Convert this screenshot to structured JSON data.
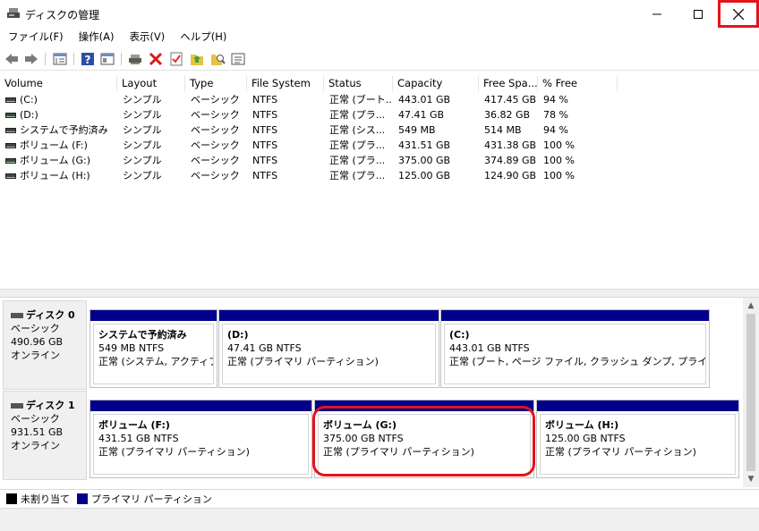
{
  "window": {
    "title": "ディスクの管理"
  },
  "menu": [
    "ファイル(F)",
    "操作(A)",
    "表示(V)",
    "ヘルプ(H)"
  ],
  "toolbar": {
    "icons": [
      "back-arrow-icon",
      "forward-arrow-icon",
      "properties-grid-icon",
      "help-icon",
      "console-tree-icon",
      "connect-icon",
      "delete-icon",
      "check-icon",
      "folder-up-icon",
      "search-folder-icon",
      "view-icon"
    ]
  },
  "volume_list": {
    "headers": [
      "Volume",
      "Layout",
      "Type",
      "File System",
      "Status",
      "Capacity",
      "Free Spa...",
      "% Free"
    ],
    "rows": [
      [
        "(C:)",
        "シンプル",
        "ベーシック",
        "NTFS",
        "正常 (ブート...",
        "443.01 GB",
        "417.45 GB",
        "94 %"
      ],
      [
        "(D:)",
        "シンプル",
        "ベーシック",
        "NTFS",
        "正常 (プラ...",
        "47.41 GB",
        "36.82 GB",
        "78 %"
      ],
      [
        "システムで予約済み",
        "シンプル",
        "ベーシック",
        "NTFS",
        "正常 (シス...",
        "549 MB",
        "514 MB",
        "94 %"
      ],
      [
        "ボリューム (F:)",
        "シンプル",
        "ベーシック",
        "NTFS",
        "正常 (プラ...",
        "431.51 GB",
        "431.38 GB",
        "100 %"
      ],
      [
        "ボリューム (G:)",
        "シンプル",
        "ベーシック",
        "NTFS",
        "正常 (プラ...",
        "375.00 GB",
        "374.89 GB",
        "100 %"
      ],
      [
        "ボリューム (H:)",
        "シンプル",
        "ベーシック",
        "NTFS",
        "正常 (プラ...",
        "125.00 GB",
        "124.90 GB",
        "100 %"
      ]
    ]
  },
  "disks": [
    {
      "name": "ディスク 0",
      "type": "ベーシック",
      "size": "490.96 GB",
      "state": "オンライン",
      "partitions": [
        {
          "name": "システムで予約済み",
          "size": "549 MB NTFS",
          "status": "正常 (システム, アクティブ, プ"
        },
        {
          "name": "(D:)",
          "size": "47.41 GB NTFS",
          "status": "正常 (プライマリ パーティション)"
        },
        {
          "name": "(C:)",
          "size": "443.01 GB NTFS",
          "status": "正常 (ブート, ページ ファイル, クラッシュ ダンプ, プライマリ パーテ"
        }
      ]
    },
    {
      "name": "ディスク 1",
      "type": "ベーシック",
      "size": "931.51 GB",
      "state": "オンライン",
      "partitions": [
        {
          "name": "ボリューム  (F:)",
          "size": "431.51 GB NTFS",
          "status": "正常 (プライマリ パーティション)"
        },
        {
          "name": "ボリューム  (G:)",
          "size": "375.00 GB NTFS",
          "status": "正常 (プライマリ パーティション)"
        },
        {
          "name": "ボリューム  (H:)",
          "size": "125.00 GB NTFS",
          "status": "正常 (プライマリ パーティション)"
        }
      ]
    }
  ],
  "legend": [
    {
      "label": "未割り当て",
      "color": "#000000"
    },
    {
      "label": "プライマリ パーティション",
      "color": "#00008b"
    }
  ],
  "colors": {
    "partition_bar": "#00008b",
    "highlight": "#e3131b"
  }
}
